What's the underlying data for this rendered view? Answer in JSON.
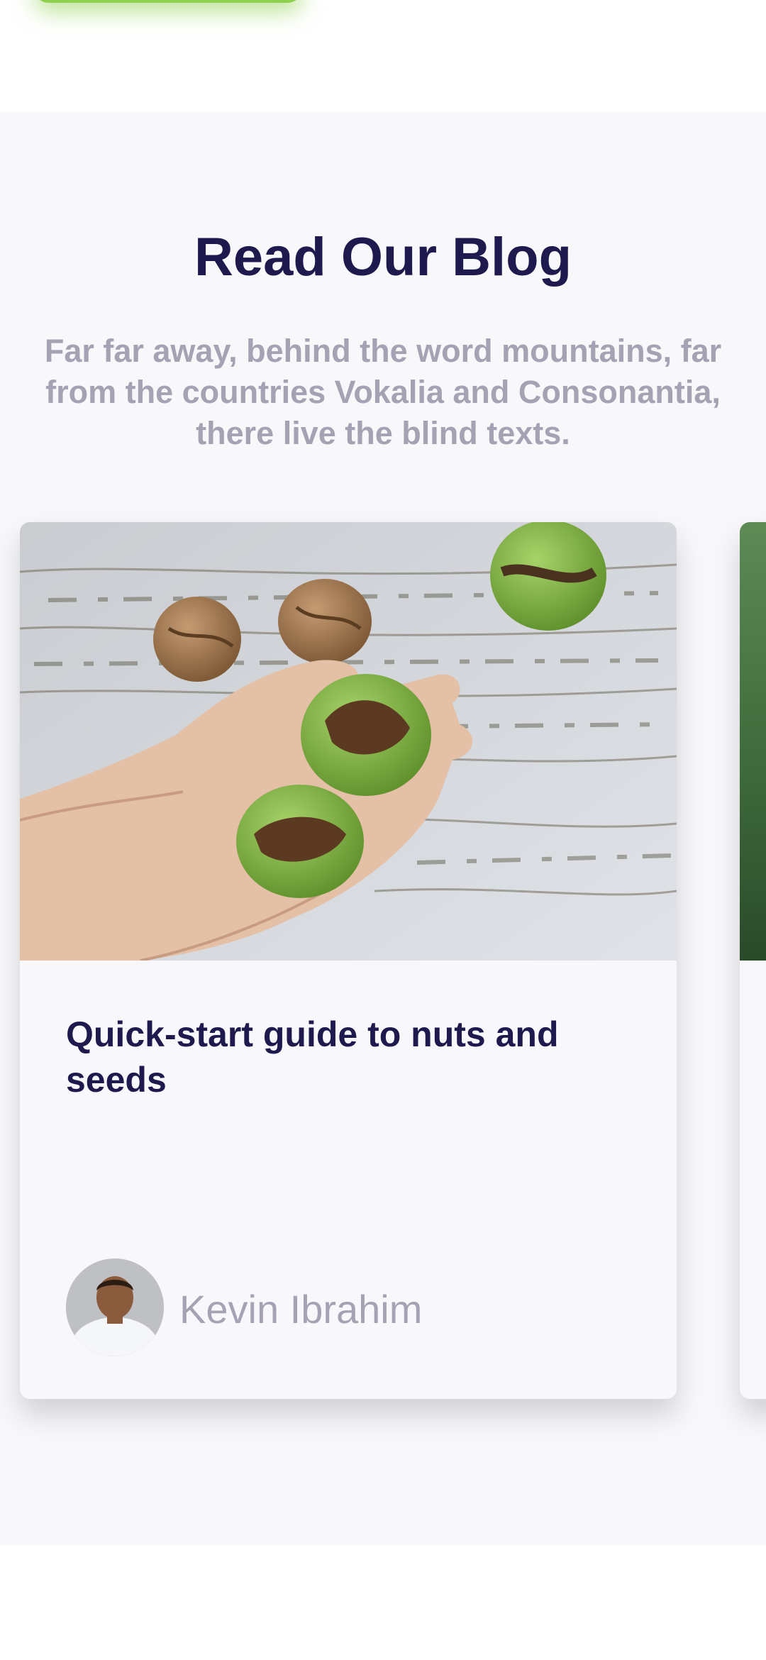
{
  "blog": {
    "title": "Read Our Blog",
    "subtitle": "Far far away, behind the word mountains, far from the countries Vokalia and Consonantia, there live the blind texts.",
    "posts": [
      {
        "title": "Quick-start guide to nuts and seeds",
        "author": "Kevin Ibrahim",
        "image_icon": "walnuts-in-hands-photo",
        "avatar_icon": "author-avatar"
      }
    ]
  },
  "colors": {
    "heading": "#1f1a4d",
    "muted": "#a4a2b3",
    "accent": "#8fd14f",
    "section_bg": "#f8f8fb"
  }
}
